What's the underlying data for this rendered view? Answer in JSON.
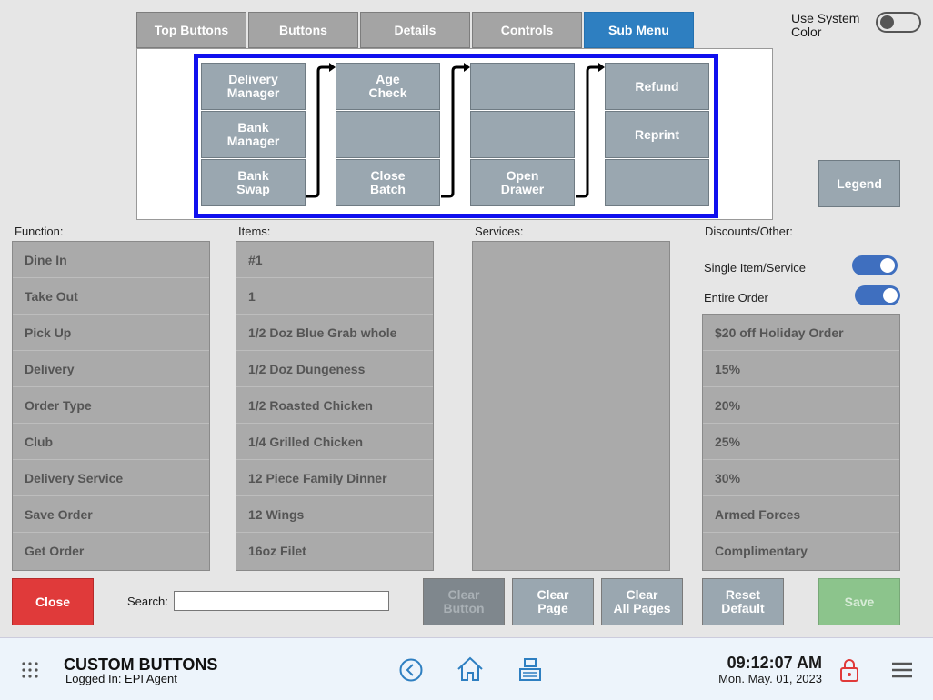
{
  "tabs": [
    {
      "label": "Top Buttons"
    },
    {
      "label": "Buttons"
    },
    {
      "label": "Details"
    },
    {
      "label": "Controls"
    },
    {
      "label": "Sub Menu",
      "active": true
    }
  ],
  "system_color": {
    "label": "Use System Color",
    "enabled": false
  },
  "submenu_grid": {
    "columns": [
      [
        "Delivery\nManager",
        "Bank\nManager",
        "Bank\nSwap"
      ],
      [
        "Age\nCheck",
        "",
        "Close\nBatch"
      ],
      [
        "",
        "",
        "Open\nDrawer"
      ],
      [
        "Refund",
        "Reprint",
        ""
      ]
    ]
  },
  "legend_label": "Legend",
  "function": {
    "label": "Function:",
    "items": [
      "Dine In",
      "Take Out",
      "Pick Up",
      "Delivery",
      "Order Type",
      "Club",
      "Delivery Service",
      "Save Order",
      "Get Order"
    ]
  },
  "items": {
    "label": "Items:",
    "items": [
      "#1",
      "1",
      "1/2 Doz Blue Grab whole",
      "1/2 Doz Dungeness",
      "1/2 Roasted Chicken",
      "1/4 Grilled Chicken",
      "12 Piece Family Dinner",
      "12 Wings",
      "16oz Filet"
    ]
  },
  "services": {
    "label": "Services:",
    "items": []
  },
  "discounts": {
    "label": "Discounts/Other:",
    "single_item_label": "Single Item/Service",
    "single_item_on": true,
    "entire_order_label": "Entire Order",
    "entire_order_on": true,
    "items": [
      "$20 off Holiday Order",
      "15%",
      "20%",
      "25%",
      "30%",
      "Armed Forces",
      "Complimentary"
    ]
  },
  "actions": {
    "close": "Close",
    "search_label": "Search:",
    "search_value": "",
    "clear_button": "Clear\nButton",
    "clear_page": "Clear\nPage",
    "clear_all_pages": "Clear\nAll Pages",
    "reset_default": "Reset\nDefault",
    "save": "Save"
  },
  "footer": {
    "title": "CUSTOM BUTTONS",
    "logged_in": "Logged In:  EPI Agent",
    "time": "09:12:07 AM",
    "date": "Mon. May. 01, 2023"
  },
  "colors": {
    "active_tab": "#2e7fc1",
    "close": "#e03a3a",
    "save": "#8cc48c",
    "frame": "#1010ee",
    "grid_button": "#9aa7b0"
  }
}
